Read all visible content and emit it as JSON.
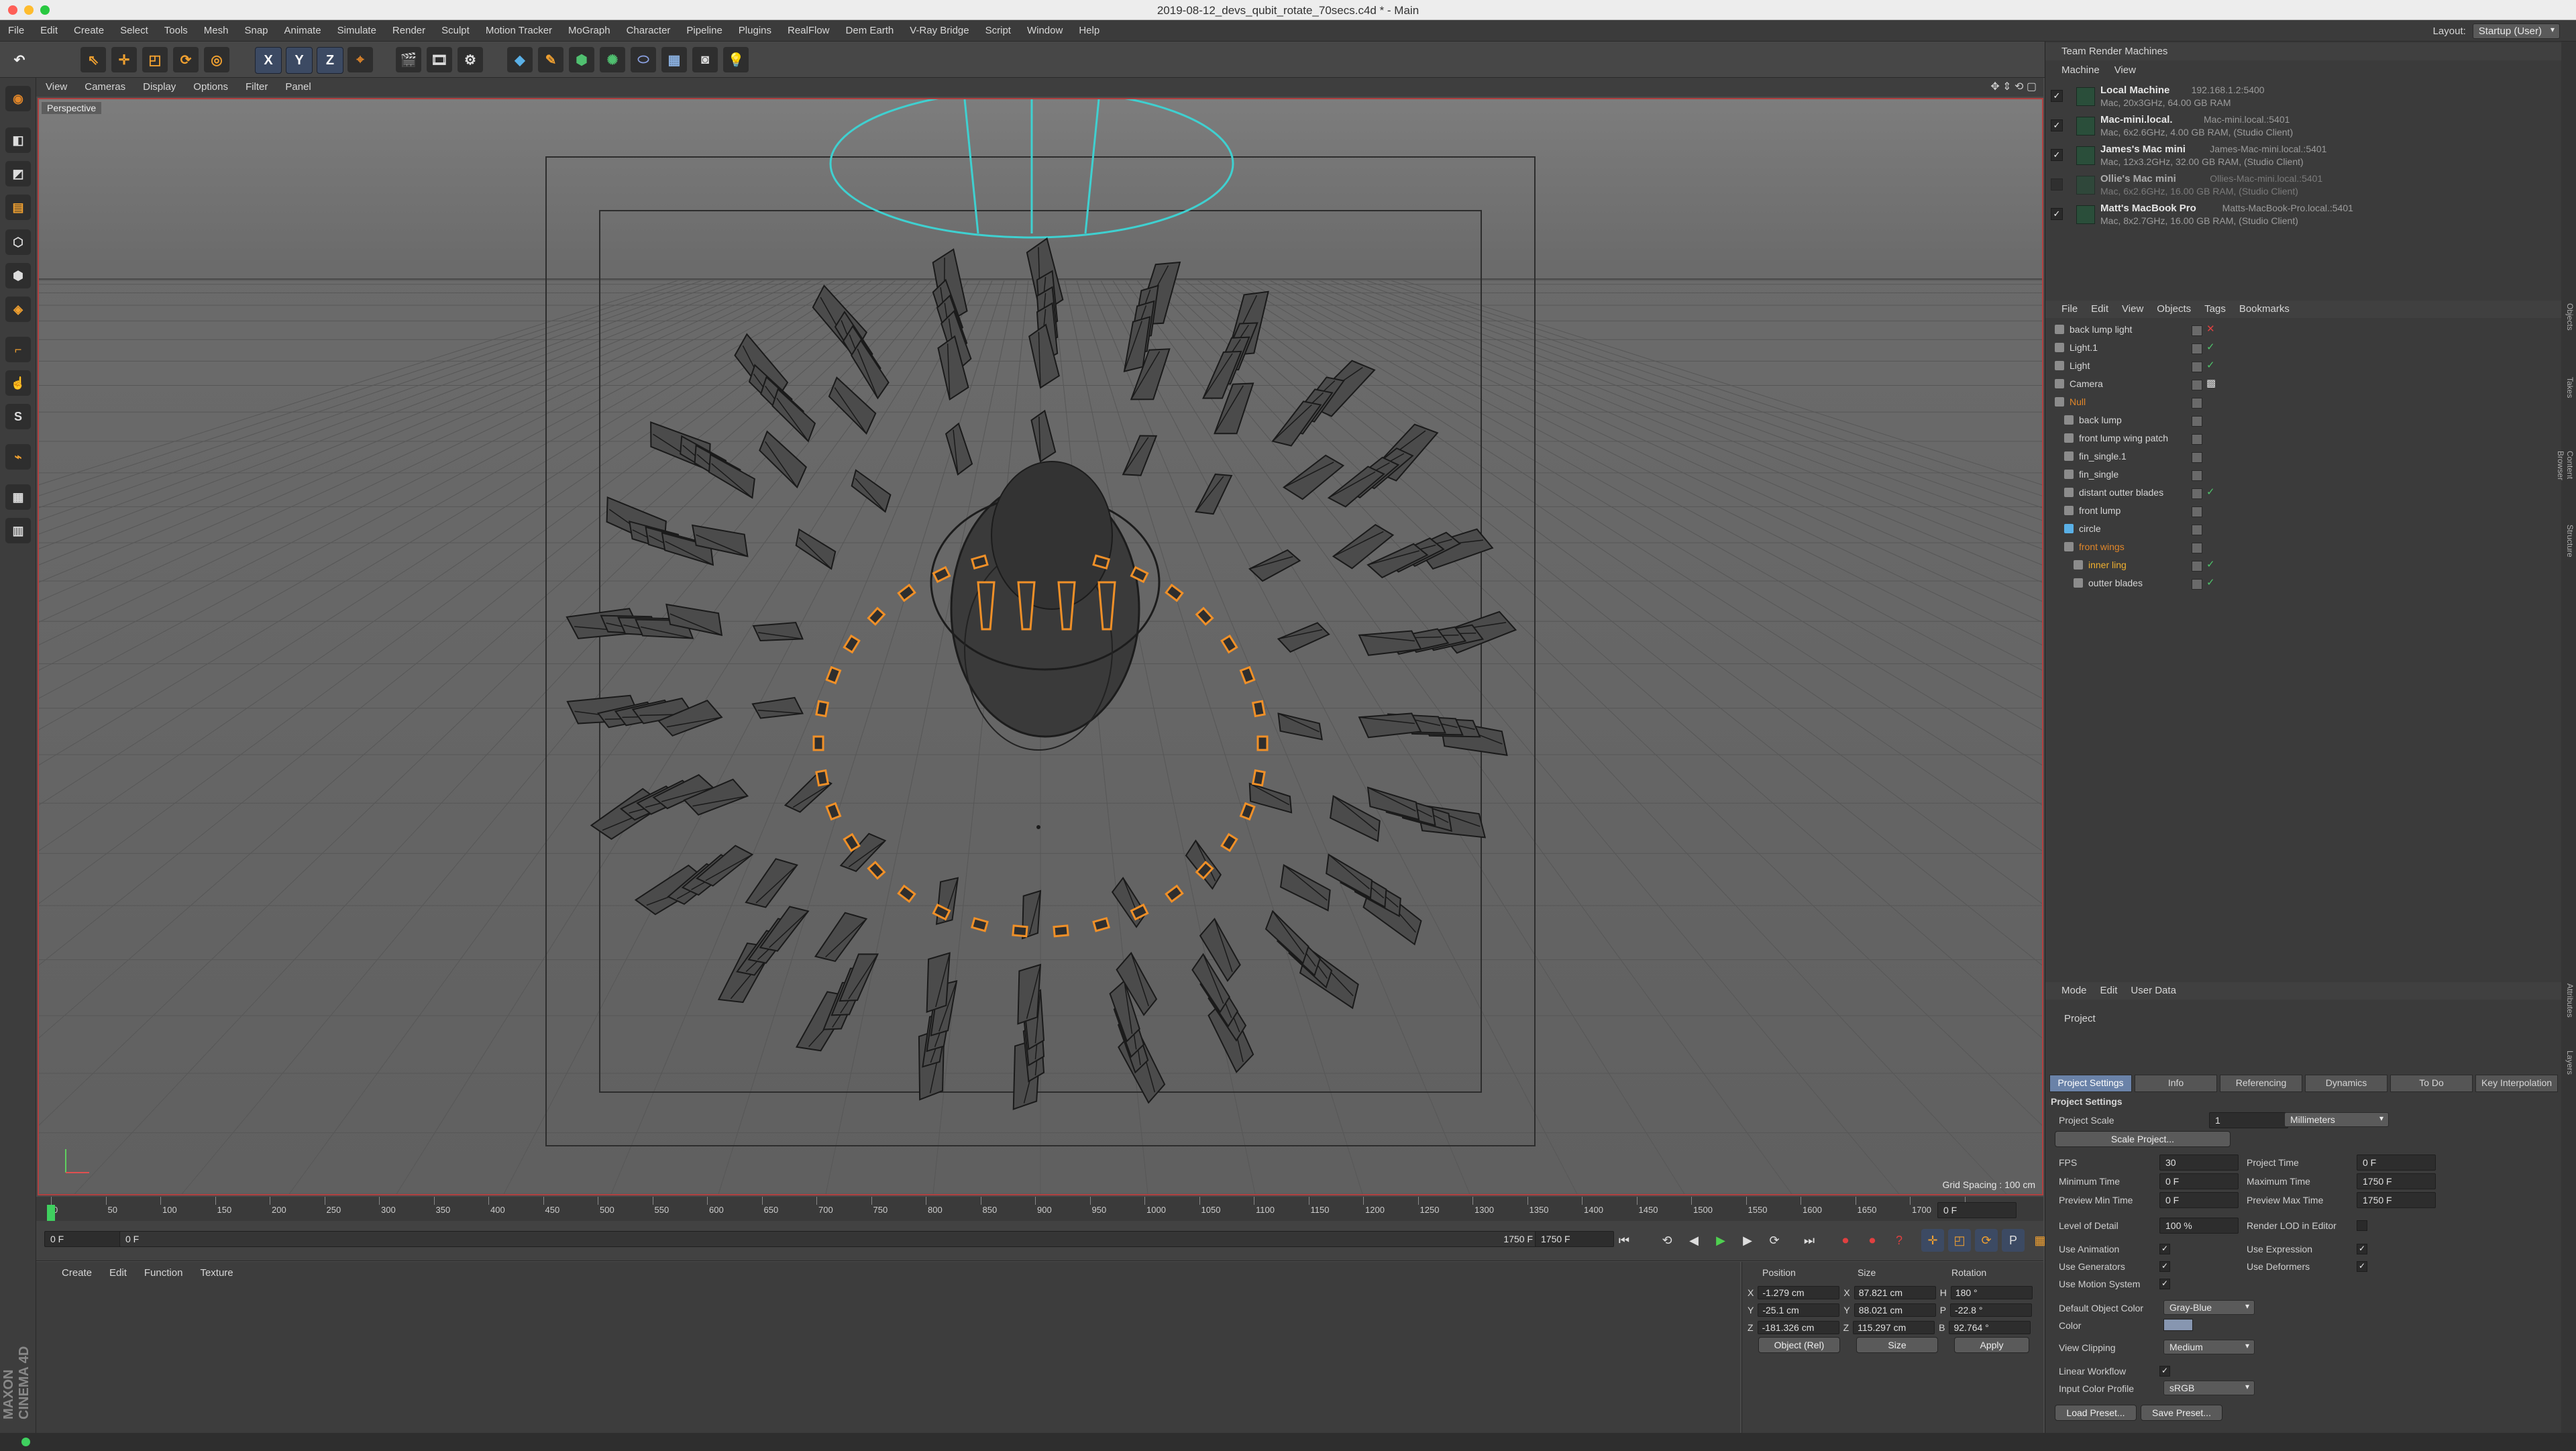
{
  "window": {
    "title": "2019-08-12_devs_qubit_rotate_70secs.c4d * - Main"
  },
  "menubar": {
    "items": [
      "File",
      "Edit",
      "Create",
      "Select",
      "Tools",
      "Mesh",
      "Snap",
      "Animate",
      "Simulate",
      "Render",
      "Sculpt",
      "Motion Tracker",
      "MoGraph",
      "Character",
      "Pipeline",
      "Plugins",
      "RealFlow",
      "Dem Earth",
      "V-Ray Bridge",
      "Script",
      "Window",
      "Help"
    ],
    "layout_label": "Layout:",
    "layout_value": "Startup (User)"
  },
  "toolbar": {
    "axis_x": "X",
    "axis_y": "Y",
    "axis_z": "Z"
  },
  "viewport": {
    "menu": [
      "View",
      "Cameras",
      "Display",
      "Options",
      "Filter",
      "Panel"
    ],
    "camera_label": "Perspective",
    "grid_spacing": "Grid Spacing : 100 cm"
  },
  "timeline": {
    "ticks": [
      "0",
      "50",
      "100",
      "150",
      "200",
      "250",
      "300",
      "350",
      "400",
      "450",
      "500",
      "550",
      "600",
      "650",
      "700",
      "750",
      "800",
      "850",
      "900",
      "950",
      "1000",
      "1050",
      "1100",
      "1150",
      "1200",
      "1250",
      "1300",
      "1350",
      "1400",
      "1450",
      "1500",
      "1550",
      "1600",
      "1650",
      "1700",
      "175"
    ],
    "current_frame": "0 F",
    "start_field": "0 F",
    "range_start": "0 F",
    "range_end": "1750 F",
    "end_field": "1750 F"
  },
  "material_panel": {
    "menu": [
      "Create",
      "Edit",
      "Function",
      "Texture"
    ]
  },
  "coordinates": {
    "headers": [
      "Position",
      "Size",
      "Rotation"
    ],
    "rows": [
      {
        "axis": "X",
        "pos": "-1.279 cm",
        "sax": "X",
        "size": "87.821 cm",
        "rax": "H",
        "rot": "180 °"
      },
      {
        "axis": "Y",
        "pos": "-25.1 cm",
        "sax": "Y",
        "size": "88.021 cm",
        "rax": "P",
        "rot": "-22.8 °"
      },
      {
        "axis": "Z",
        "pos": "-181.326 cm",
        "sax": "Z",
        "size": "115.297 cm",
        "rax": "B",
        "rot": "92.764 °"
      }
    ],
    "mode_select": "Object (Rel)",
    "size_select": "Size",
    "apply": "Apply"
  },
  "team_render": {
    "title": "Team Render Machines",
    "menu": [
      "Machine",
      "View"
    ],
    "machines": [
      {
        "name": "Local Machine",
        "ip": "192.168.1.2:5400",
        "details": "Mac, 20x3GHz, 64.00 GB RAM",
        "checked": true
      },
      {
        "name": "Mac-mini.local.",
        "ip": "Mac-mini.local.:5401",
        "details": "Mac, 6x2.6GHz, 4.00 GB RAM, (Studio Client)",
        "checked": true
      },
      {
        "name": "James's Mac mini",
        "ip": "James-Mac-mini.local.:5401",
        "details": "Mac, 12x3.2GHz, 32.00 GB RAM, (Studio Client)",
        "checked": true
      },
      {
        "name": "Ollie's Mac mini",
        "ip": "Ollies-Mac-mini.local.:5401",
        "details": "Mac, 6x2.6GHz, 16.00 GB RAM, (Studio Client)",
        "checked": false
      },
      {
        "name": "Matt's MacBook Pro",
        "ip": "Matts-MacBook-Pro.local.:5401",
        "details": "Mac, 8x2.7GHz, 16.00 GB RAM, (Studio Client)",
        "checked": true
      }
    ]
  },
  "objects": {
    "menu": [
      "File",
      "Edit",
      "View",
      "Objects",
      "Tags",
      "Bookmarks"
    ],
    "items": [
      {
        "name": "back lump light",
        "indent": 0,
        "color": "#d6d6d6",
        "mark": "x"
      },
      {
        "name": "Light.1",
        "indent": 0,
        "color": "#d6d6d6",
        "mark": "check"
      },
      {
        "name": "Light",
        "indent": 0,
        "color": "#d6d6d6",
        "mark": "check"
      },
      {
        "name": "Camera",
        "indent": 0,
        "color": "#d6d6d6",
        "mark": "tag"
      },
      {
        "name": "Null",
        "indent": 0,
        "color": "#e0862a",
        "mark": ""
      },
      {
        "name": "back lump",
        "indent": 1,
        "color": "#d6d6d6",
        "mark": ""
      },
      {
        "name": "front lump wing patch",
        "indent": 1,
        "color": "#d6d6d6",
        "mark": ""
      },
      {
        "name": "fin_single.1",
        "indent": 1,
        "color": "#d6d6d6",
        "mark": ""
      },
      {
        "name": "fin_single",
        "indent": 1,
        "color": "#d6d6d6",
        "mark": ""
      },
      {
        "name": "distant outter blades",
        "indent": 1,
        "color": "#d6d6d6",
        "mark": "check"
      },
      {
        "name": "front lump",
        "indent": 1,
        "color": "#d6d6d6",
        "mark": ""
      },
      {
        "name": "circle",
        "indent": 1,
        "color": "#d6d6d6",
        "mark": ""
      },
      {
        "name": "front wings",
        "indent": 1,
        "color": "#e0862a",
        "mark": ""
      },
      {
        "name": "inner ling",
        "indent": 2,
        "color": "#f0b030",
        "mark": "check"
      },
      {
        "name": "outter blades",
        "indent": 2,
        "color": "#d6d6d6",
        "mark": "check"
      }
    ]
  },
  "attributes": {
    "menu": [
      "Mode",
      "Edit",
      "User Data"
    ],
    "object": "Project",
    "tabs": [
      "Project Settings",
      "Info",
      "Referencing",
      "Dynamics",
      "To Do",
      "Key Interpolation"
    ],
    "section": "Project Settings",
    "project_scale_label": "Project Scale",
    "project_scale": "1",
    "project_scale_unit": "Millimeters",
    "scale_project_btn": "Scale Project...",
    "fps_label": "FPS",
    "fps": "30",
    "project_time_label": "Project Time",
    "project_time": "0 F",
    "min_time_label": "Minimum Time",
    "min_time": "0 F",
    "max_time_label": "Maximum Time",
    "max_time": "1750 F",
    "preview_min_label": "Preview Min Time",
    "preview_min": "0 F",
    "preview_max_label": "Preview Max Time",
    "preview_max": "1750 F",
    "lod_label": "Level of Detail",
    "lod": "100 %",
    "render_lod_label": "Render LOD in Editor",
    "use_animation": "Use Animation",
    "use_expression": "Use Expression",
    "use_generators": "Use Generators",
    "use_deformers": "Use Deformers",
    "use_motion": "Use Motion System",
    "default_color_label": "Default Object Color",
    "default_color": "Gray-Blue",
    "color_label": "Color",
    "view_clipping_label": "View Clipping",
    "view_clipping": "Medium",
    "linear_workflow": "Linear Workflow",
    "input_profile_label": "Input Color Profile",
    "input_profile": "sRGB",
    "load_preset": "Load Preset...",
    "save_preset": "Save Preset..."
  },
  "right_vtabs": [
    "Objects",
    "Takes",
    "Content Browser",
    "Structure"
  ],
  "right_vtabs2": [
    "Attributes",
    "Layers"
  ],
  "brand": "MAXON CINEMA 4D"
}
